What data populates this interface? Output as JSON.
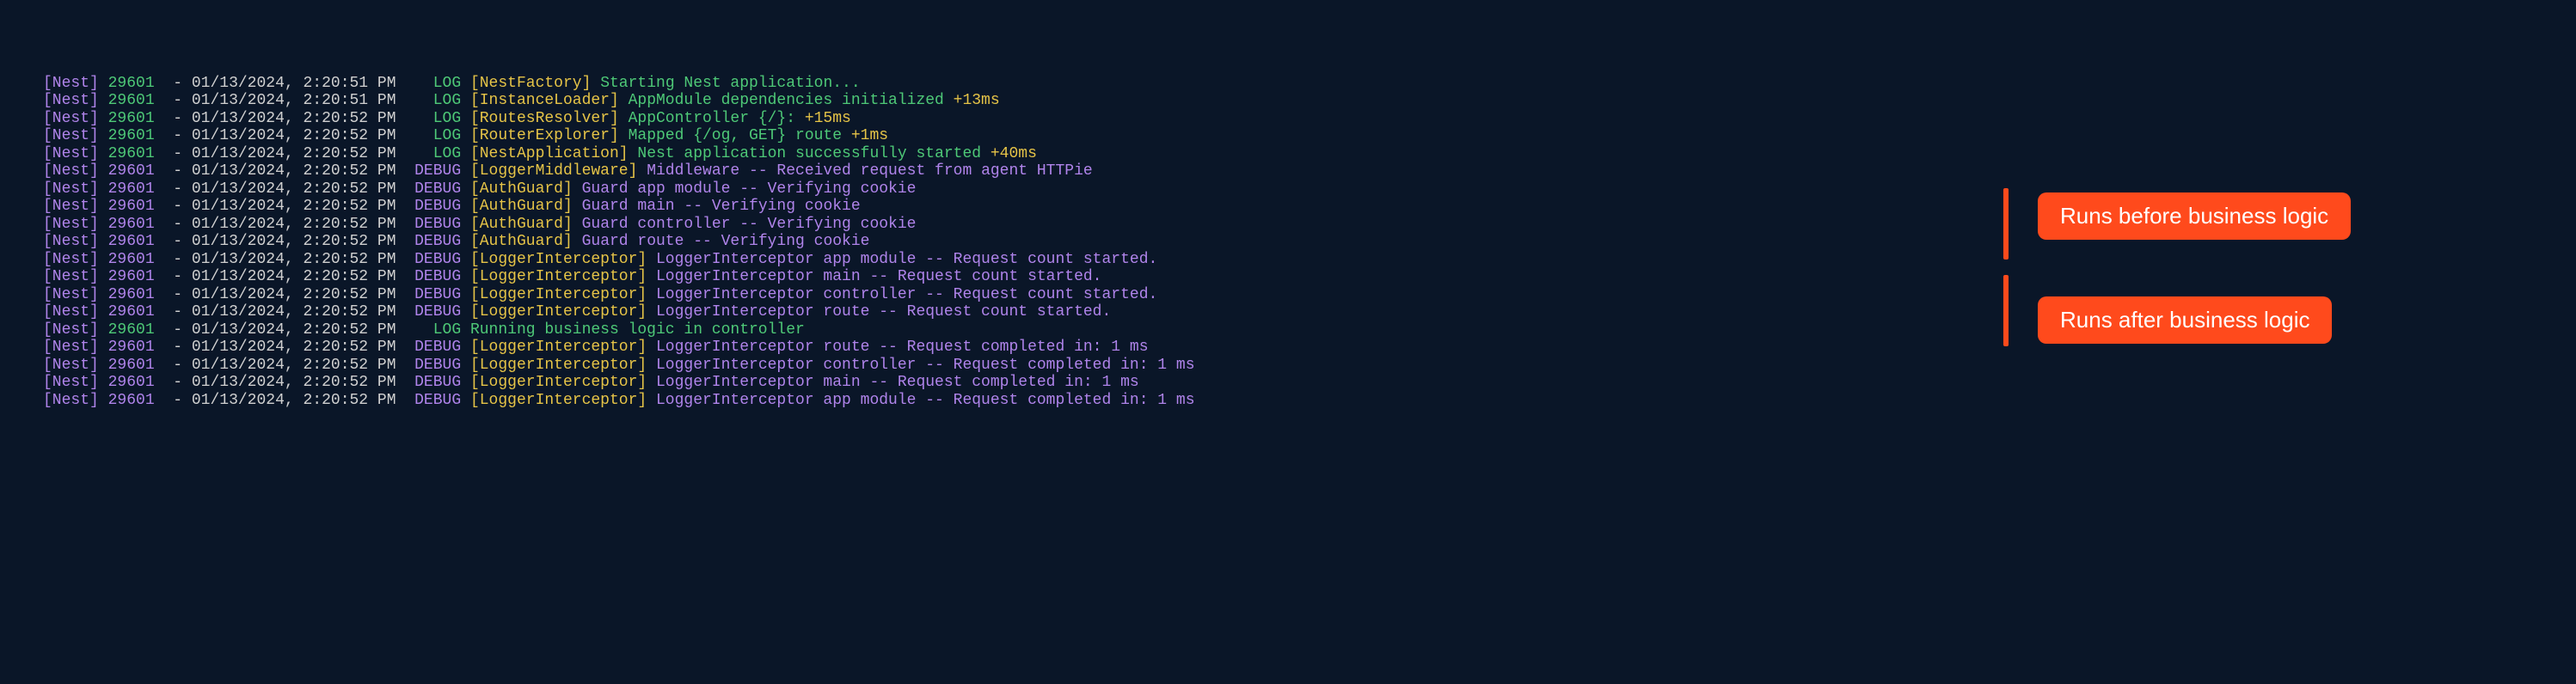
{
  "badges": {
    "before": "Runs before business logic",
    "after": "Runs after business logic"
  },
  "lines": [
    {
      "tag": "[Nest]",
      "pid": "29601",
      "pidColor": "green",
      "ts": "01/13/2024, 2:20:51 PM",
      "level": "LOG",
      "levelPad": "    ",
      "context": "[NestFactory]",
      "msg": "Starting Nest application...",
      "msgColor": "green",
      "timing": ""
    },
    {
      "tag": "[Nest]",
      "pid": "29601",
      "pidColor": "green",
      "ts": "01/13/2024, 2:20:51 PM",
      "level": "LOG",
      "levelPad": "    ",
      "context": "[InstanceLoader]",
      "msg": "AppModule dependencies initialized ",
      "msgColor": "green",
      "timing": "+13ms"
    },
    {
      "tag": "[Nest]",
      "pid": "29601",
      "pidColor": "green",
      "ts": "01/13/2024, 2:20:52 PM",
      "level": "LOG",
      "levelPad": "    ",
      "context": "[RoutesResolver]",
      "msg": "AppController {/}: ",
      "msgColor": "green",
      "timing": "+15ms"
    },
    {
      "tag": "[Nest]",
      "pid": "29601",
      "pidColor": "green",
      "ts": "01/13/2024, 2:20:52 PM",
      "level": "LOG",
      "levelPad": "    ",
      "context": "[RouterExplorer]",
      "msg": "Mapped {/og, GET} route ",
      "msgColor": "green",
      "timing": "+1ms"
    },
    {
      "tag": "[Nest]",
      "pid": "29601",
      "pidColor": "green",
      "ts": "01/13/2024, 2:20:52 PM",
      "level": "LOG",
      "levelPad": "    ",
      "context": "[NestApplication]",
      "msg": "Nest application successfully started ",
      "msgColor": "green",
      "timing": "+40ms"
    },
    {
      "tag": "[Nest]",
      "pid": "29601",
      "pidColor": "purple",
      "ts": "01/13/2024, 2:20:52 PM",
      "level": "DEBUG",
      "levelPad": "  ",
      "context": "[LoggerMiddleware]",
      "msg": "Middleware -- Received request from agent HTTPie",
      "msgColor": "purple",
      "timing": ""
    },
    {
      "tag": "[Nest]",
      "pid": "29601",
      "pidColor": "purple",
      "ts": "01/13/2024, 2:20:52 PM",
      "level": "DEBUG",
      "levelPad": "  ",
      "context": "[AuthGuard]",
      "msg": "Guard app module -- Verifying cookie",
      "msgColor": "purple",
      "timing": ""
    },
    {
      "tag": "[Nest]",
      "pid": "29601",
      "pidColor": "purple",
      "ts": "01/13/2024, 2:20:52 PM",
      "level": "DEBUG",
      "levelPad": "  ",
      "context": "[AuthGuard]",
      "msg": "Guard main -- Verifying cookie",
      "msgColor": "purple",
      "timing": ""
    },
    {
      "tag": "[Nest]",
      "pid": "29601",
      "pidColor": "purple",
      "ts": "01/13/2024, 2:20:52 PM",
      "level": "DEBUG",
      "levelPad": "  ",
      "context": "[AuthGuard]",
      "msg": "Guard controller -- Verifying cookie",
      "msgColor": "purple",
      "timing": ""
    },
    {
      "tag": "[Nest]",
      "pid": "29601",
      "pidColor": "purple",
      "ts": "01/13/2024, 2:20:52 PM",
      "level": "DEBUG",
      "levelPad": "  ",
      "context": "[AuthGuard]",
      "msg": "Guard route -- Verifying cookie",
      "msgColor": "purple",
      "timing": ""
    },
    {
      "tag": "[Nest]",
      "pid": "29601",
      "pidColor": "purple",
      "ts": "01/13/2024, 2:20:52 PM",
      "level": "DEBUG",
      "levelPad": "  ",
      "context": "[LoggerInterceptor]",
      "msg": "LoggerInterceptor app module -- Request count started.",
      "msgColor": "purple",
      "timing": ""
    },
    {
      "tag": "[Nest]",
      "pid": "29601",
      "pidColor": "purple",
      "ts": "01/13/2024, 2:20:52 PM",
      "level": "DEBUG",
      "levelPad": "  ",
      "context": "[LoggerInterceptor]",
      "msg": "LoggerInterceptor main -- Request count started.",
      "msgColor": "purple",
      "timing": ""
    },
    {
      "tag": "[Nest]",
      "pid": "29601",
      "pidColor": "purple",
      "ts": "01/13/2024, 2:20:52 PM",
      "level": "DEBUG",
      "levelPad": "  ",
      "context": "[LoggerInterceptor]",
      "msg": "LoggerInterceptor controller -- Request count started.",
      "msgColor": "purple",
      "timing": ""
    },
    {
      "tag": "[Nest]",
      "pid": "29601",
      "pidColor": "purple",
      "ts": "01/13/2024, 2:20:52 PM",
      "level": "DEBUG",
      "levelPad": "  ",
      "context": "[LoggerInterceptor]",
      "msg": "LoggerInterceptor route -- Request count started.",
      "msgColor": "purple",
      "timing": ""
    },
    {
      "tag": "[Nest]",
      "pid": "29601",
      "pidColor": "green",
      "ts": "01/13/2024, 2:20:52 PM",
      "level": "LOG",
      "levelPad": "    ",
      "context": "",
      "msg": "Running business logic in controller",
      "msgColor": "green",
      "timing": ""
    },
    {
      "tag": "[Nest]",
      "pid": "29601",
      "pidColor": "purple",
      "ts": "01/13/2024, 2:20:52 PM",
      "level": "DEBUG",
      "levelPad": "  ",
      "context": "[LoggerInterceptor]",
      "msg": "LoggerInterceptor route -- Request completed in: 1 ms",
      "msgColor": "purple",
      "timing": ""
    },
    {
      "tag": "[Nest]",
      "pid": "29601",
      "pidColor": "purple",
      "ts": "01/13/2024, 2:20:52 PM",
      "level": "DEBUG",
      "levelPad": "  ",
      "context": "[LoggerInterceptor]",
      "msg": "LoggerInterceptor controller -- Request completed in: 1 ms",
      "msgColor": "purple",
      "timing": ""
    },
    {
      "tag": "[Nest]",
      "pid": "29601",
      "pidColor": "purple",
      "ts": "01/13/2024, 2:20:52 PM",
      "level": "DEBUG",
      "levelPad": "  ",
      "context": "[LoggerInterceptor]",
      "msg": "LoggerInterceptor main -- Request completed in: 1 ms",
      "msgColor": "purple",
      "timing": ""
    },
    {
      "tag": "[Nest]",
      "pid": "29601",
      "pidColor": "purple",
      "ts": "01/13/2024, 2:20:52 PM",
      "level": "DEBUG",
      "levelPad": "  ",
      "context": "[LoggerInterceptor]",
      "msg": "LoggerInterceptor app module -- Request completed in: 1 ms",
      "msgColor": "purple",
      "timing": ""
    }
  ]
}
